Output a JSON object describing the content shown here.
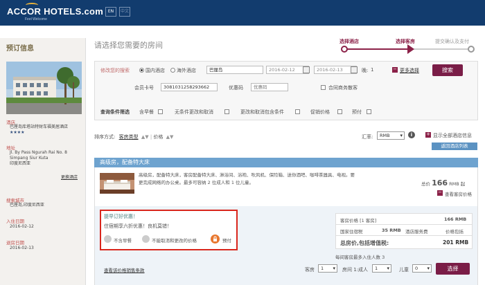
{
  "header": {
    "logo": "ACCOR HOTELS.com",
    "tagline": "Feel Welcome",
    "lang_en": "EN",
    "lang_zh": "中文"
  },
  "sidebar": {
    "title": "预订信息",
    "hotel_label": "酒店",
    "hotel_name": "巴厘岛库塔站特财车福美居酒店",
    "stars": "★★★★",
    "address_label": "地址",
    "address": [
      "Jl. By Pass Ngurah Rai No. 8",
      "Simpang Siur Kuta",
      "印度尼西亚"
    ],
    "more_hotel": "更换酒店",
    "city_label": "搜索城市",
    "city": "巴厘岛,印度尼西亚",
    "checkin_label": "入住日期",
    "checkin": "2016-02-12",
    "checkout_label": "退房日期",
    "checkout": "2016-02-13"
  },
  "main": {
    "title": "请选择您需要的房间",
    "steps": [
      "选择酒店",
      "选择客房",
      "提交确认及支付"
    ]
  },
  "search": {
    "modify_label": "修改您的搜索",
    "radio_domestic": "国内酒店",
    "radio_overseas": "海外酒店",
    "destination": "巴厘岛",
    "date_in": "2016-02-12",
    "date_out": "2016-02-13",
    "nights_label": "晚:",
    "nights": "1",
    "more_options": "更多选择",
    "search_button": "搜索",
    "member_label": "会员卡号",
    "member_value": "3081031258293662",
    "promo_label": "优惠码",
    "promo_placeholder": "优惠码",
    "corporate": "合同商务散客",
    "filter_label": "查询条件筛选",
    "filters": [
      "含早餐",
      "无条件更改和取消",
      "更改和取消包含条件",
      "促销价格",
      "预付"
    ]
  },
  "sort": {
    "label": "排序方式:",
    "by_type": "客房类型",
    "by_price": "价格",
    "currency_label": "汇率:",
    "currency": "RMB",
    "show_all": "显示全部酒店信息",
    "back_list": "返回酒店列表"
  },
  "room": {
    "name": "高级房，配备特大床",
    "description": "高级房，配备特大床，客房配备特大床、淋浴间、浴袍、吹风机、保险箱、迷你酒吧、咖啡茶器具、电视。要更完成网络的办公桌。最多可容纳 2 位成人和 1 位儿童。",
    "from_label": "总价",
    "price": "166",
    "price_unit": "RMB 起",
    "view_rooms": "查看客房价格"
  },
  "rate": {
    "title": "提早订好优惠！",
    "desc": "住宿期享六折优惠！良机莫错！",
    "tag1": "不含早餐",
    "tag2": "不能取消和更改的价格",
    "tag3": "预付",
    "room_price_label": "客房价格 [1 客房]",
    "room_price": "166 RMB",
    "tax_label": "国家住宿税",
    "tax": "35 RMB",
    "service_label": "酒店服务费",
    "service": "价格包括",
    "total_label": "总房价,包括增值税:",
    "total": "201 RMB",
    "occupancy": "每间客房最多入住人数 3",
    "terms_link": "查看该价格销售条款",
    "rooms_label": "客房",
    "rooms_value": "1",
    "adults_label": "房间 1:成人",
    "adults_value": "1",
    "children_label": "儿童",
    "children_value": "0",
    "select_button": "选择"
  }
}
